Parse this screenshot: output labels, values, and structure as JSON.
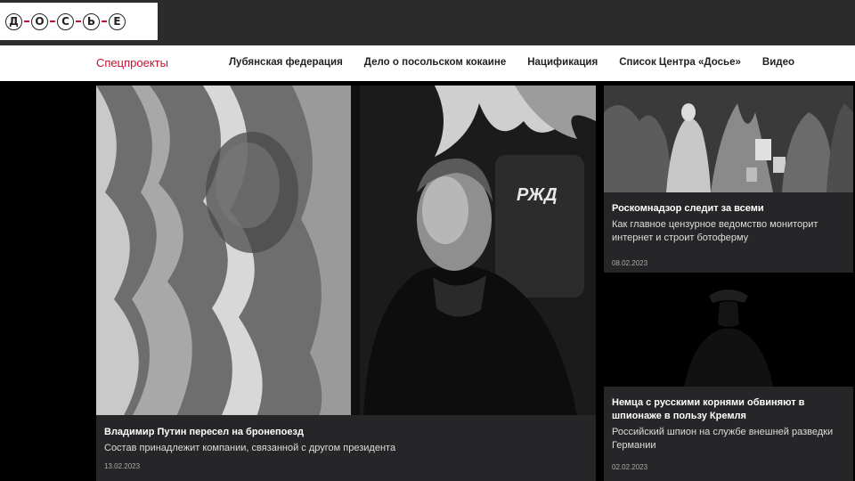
{
  "header": {
    "logo_letters": [
      "Д",
      "О",
      "С",
      "Ь",
      "Е"
    ]
  },
  "nav": {
    "special_label": "Спецпроекты",
    "links": [
      "Лубянская федерация",
      "Дело о посольском кокаине",
      "Нацификация",
      "Список Центра «Досье»",
      "Видео"
    ]
  },
  "articles": [
    {
      "title": "Владимир Путин пересел на бронепоезд",
      "subtitle": "Состав принадлежит компании, связанной с другом президента",
      "date": "13.02.2023",
      "image_label": "РЖД"
    },
    {
      "title": "Роскомнадзор следит за всеми",
      "subtitle": "Как главное цензурное ведомство мониторит интернет и строит ботоферму",
      "date": "08.02.2023"
    },
    {
      "title": "Немца с русскими корнями обвиняют в шпионаже в пользу Кремля",
      "subtitle": "Российский шпион на службе внешней разведки Германии",
      "date": "02.02.2023"
    }
  ],
  "colors": {
    "accent": "#c8102e",
    "caption_bg": "#262628",
    "topbar_bg": "#2b2b2b"
  }
}
